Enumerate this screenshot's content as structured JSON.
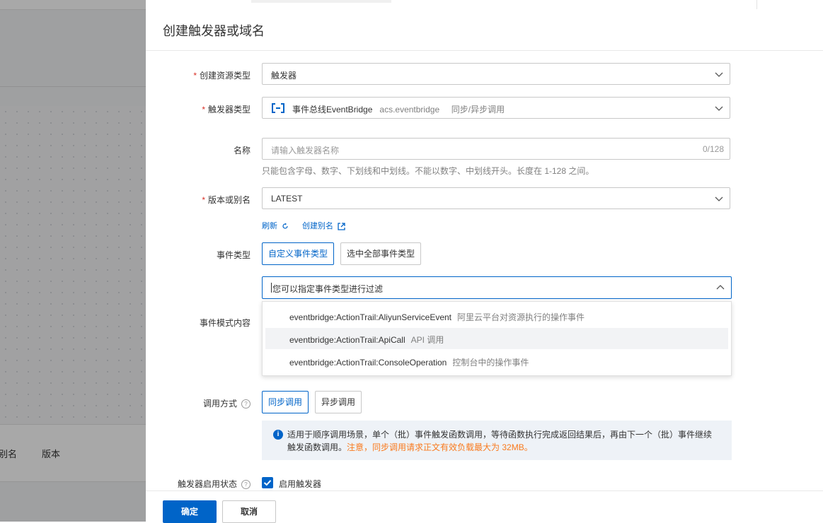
{
  "background": {
    "table_columns": [
      "别名",
      "版本"
    ]
  },
  "drawer": {
    "title": "创建触发器或域名",
    "fields": {
      "resource_type": {
        "label": "创建资源类型",
        "value": "触发器"
      },
      "trigger_type": {
        "label": "触发器类型",
        "name": "事件总线EventBridge",
        "code": "acs.eventbridge",
        "mode": "同步/异步调用"
      },
      "name": {
        "label": "名称",
        "placeholder": "请输入触发器名称",
        "counter": "0/128",
        "hint": "只能包含字母、数字、下划线和中划线。不能以数字、中划线开头。长度在 1-128 之间。"
      },
      "version": {
        "label": "版本或别名",
        "value": "LATEST",
        "refresh_link": "刷新",
        "create_alias_link": "创建别名"
      },
      "event_type": {
        "label": "事件类型",
        "options": [
          "自定义事件类型",
          "选中全部事件类型"
        ],
        "selected": "自定义事件类型"
      },
      "event_pattern": {
        "label": "事件模式内容",
        "search_placeholder": "您可以指定事件类型进行过滤",
        "dropdown": [
          {
            "code": "eventbridge:ActionTrail:AliyunServiceEvent",
            "desc": "阿里云平台对资源执行的操作事件"
          },
          {
            "code": "eventbridge:ActionTrail:ApiCall",
            "desc": "API 调用"
          },
          {
            "code": "eventbridge:ActionTrail:ConsoleOperation",
            "desc": "控制台中的操作事件"
          }
        ]
      },
      "invoke_mode": {
        "label": "调用方式",
        "options": [
          "同步调用",
          "异步调用"
        ],
        "selected": "同步调用",
        "notice": "适用于顺序调用场景，单个（批）事件触发函数调用，等待函数执行完成返回结果后，再由下一个（批）事件继续触发函数调用。",
        "notice_warning": "注意，同步调用请求正文有效负载最大为 32MB。"
      },
      "trigger_status": {
        "label": "触发器启用状态",
        "checkbox_label": "启用触发器",
        "checked": true
      }
    },
    "footer": {
      "confirm": "确定",
      "cancel": "取消"
    }
  },
  "colors": {
    "primary": "#0064c8",
    "required": "#d93026",
    "warning": "#f97a1e"
  }
}
